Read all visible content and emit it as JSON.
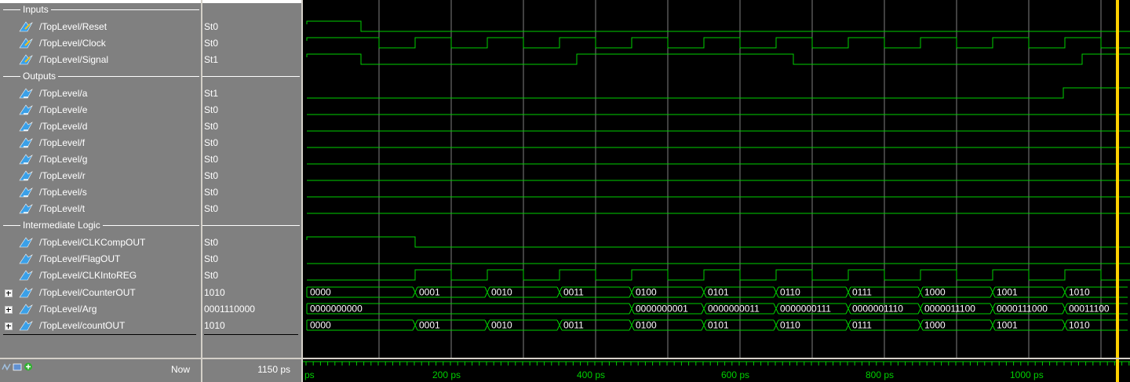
{
  "groups": {
    "inputs": "Inputs",
    "outputs": "Outputs",
    "intermediate": "Intermediate Logic"
  },
  "signals": [
    {
      "name": "/TopLevel/Reset",
      "value": "St0"
    },
    {
      "name": "/TopLevel/Clock",
      "value": "St0"
    },
    {
      "name": "/TopLevel/Signal",
      "value": "St1"
    },
    {
      "name": "/TopLevel/a",
      "value": "St1"
    },
    {
      "name": "/TopLevel/e",
      "value": "St0"
    },
    {
      "name": "/TopLevel/d",
      "value": "St0"
    },
    {
      "name": "/TopLevel/f",
      "value": "St0"
    },
    {
      "name": "/TopLevel/g",
      "value": "St0"
    },
    {
      "name": "/TopLevel/r",
      "value": "St0"
    },
    {
      "name": "/TopLevel/s",
      "value": "St0"
    },
    {
      "name": "/TopLevel/t",
      "value": "St0"
    },
    {
      "name": "/TopLevel/CLKCompOUT",
      "value": "St0"
    },
    {
      "name": "/TopLevel/FlagOUT",
      "value": "St0"
    },
    {
      "name": "/TopLevel/CLKIntoREG",
      "value": "St0"
    },
    {
      "name": "/TopLevel/CounterOUT",
      "value": "1010"
    },
    {
      "name": "/TopLevel/Arg",
      "value": "0001110000"
    },
    {
      "name": "/TopLevel/countOUT",
      "value": "1010"
    }
  ],
  "footer": {
    "now_label": "Now",
    "now_value": "1150 ps",
    "time_labels": [
      "ps",
      "200 ps",
      "400 ps",
      "600 ps",
      "800 ps",
      "1000 ps"
    ]
  },
  "bus_values": {
    "CounterOUT": [
      "0000",
      "0001",
      "0010",
      "0011",
      "0100",
      "0101",
      "0110",
      "0111",
      "1000",
      "1001",
      "1010"
    ],
    "Arg": [
      "0000000000",
      "0000000001",
      "0000000011",
      "0000000111",
      "0000001110",
      "0000011100",
      "0000111000",
      "00011100"
    ],
    "countOUT": [
      "0000",
      "0001",
      "0010",
      "0011",
      "0100",
      "0101",
      "0110",
      "0111",
      "1000",
      "1001",
      "1010"
    ]
  },
  "colors": {
    "wave": "#00d000",
    "cursor": "#ffd000",
    "grid": "#808080",
    "panel": "#808080"
  }
}
